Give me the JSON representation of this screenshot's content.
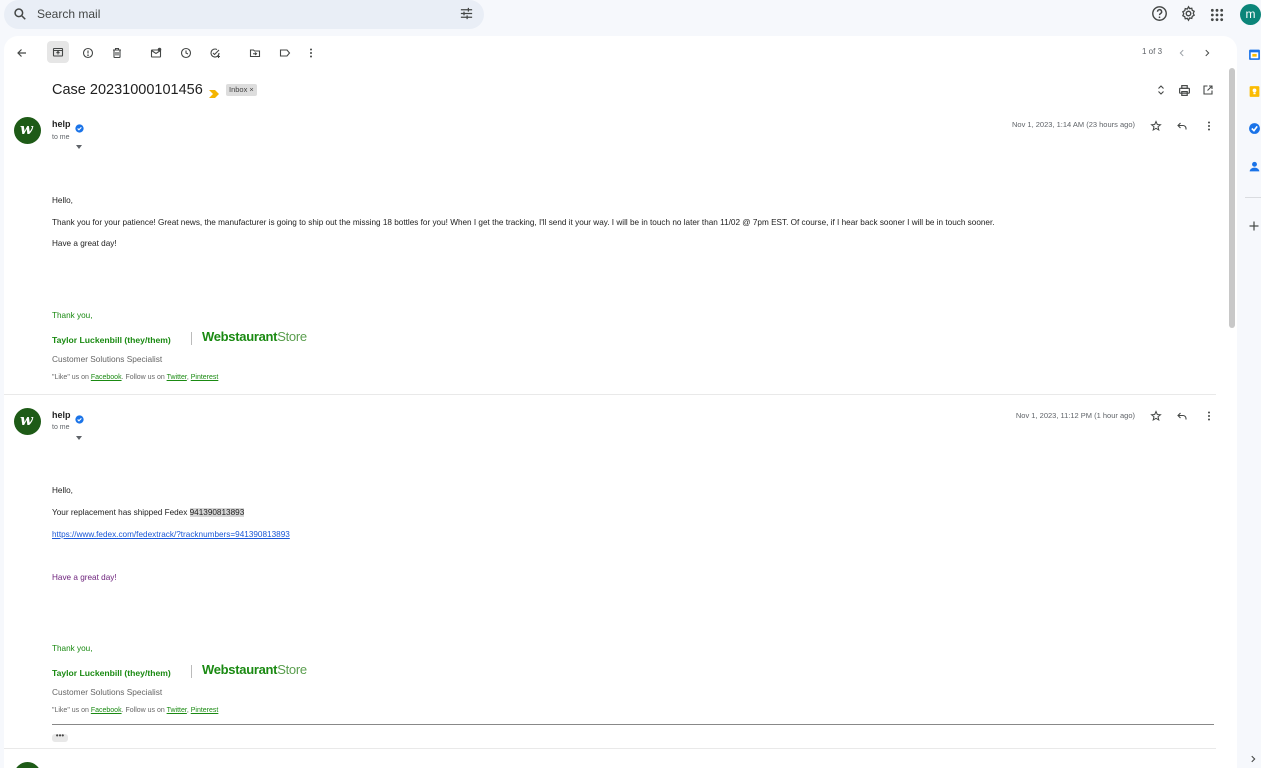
{
  "search": {
    "placeholder": "Search mail"
  },
  "account": {
    "initial": "m"
  },
  "pager": {
    "text": "1 of 3"
  },
  "thread": {
    "subject": "Case 20231000101456",
    "label": "Inbox ×"
  },
  "messages": [
    {
      "sender": "help",
      "to": "to me",
      "date": "Nov 1, 2023, 1:14 AM (23 hours ago)",
      "greeting": "Hello,",
      "body": " Thank you for your patience! Great news, the manufacturer is going to ship out the missing 18 bottles for you! When I get the tracking, I'll send it your way.  I will be in touch no later than 11/02 @ 7pm EST. Of course, if I hear back sooner I will be in touch sooner.",
      "closing": "Have a great day!",
      "thanks": "Thank you,",
      "sig_name": "Taylor Luckenbill (they/them)",
      "sig_title": "Customer Solutions Specialist",
      "social_pre": "\"Like\" us on ",
      "social_fb": "Facebook",
      "social_mid": ". Follow us on ",
      "social_tw": "Twitter",
      "social_comma": ", ",
      "social_pin": "Pinterest"
    },
    {
      "sender": "help",
      "to": "to me",
      "date": "Nov 1, 2023, 11:12 PM (1 hour ago)",
      "greeting": "Hello,",
      "body_pre": "Your replacement has shipped Fedex ",
      "tracking": "941390813893",
      "link": "https://www.fedex.com/fedextrack/?tracknumbers=941390813893",
      "closing": "Have a great day!",
      "thanks": "Thank you,",
      "sig_name": "Taylor Luckenbill (they/them)",
      "sig_title": "Customer Solutions Specialist",
      "social_pre": "\"Like\" us on ",
      "social_fb": "Facebook",
      "social_mid": ". Follow us on ",
      "social_tw": "Twitter",
      "social_comma": ", ",
      "social_pin": "Pinterest",
      "more": "•••"
    }
  ],
  "logo": {
    "bold": "Webstaurant",
    "light": "Store"
  },
  "colors": {
    "brand_green": "#1a8a12",
    "avatar_green": "#1e5b17",
    "account_teal": "#0b8579",
    "link_blue": "#1a57d6"
  }
}
